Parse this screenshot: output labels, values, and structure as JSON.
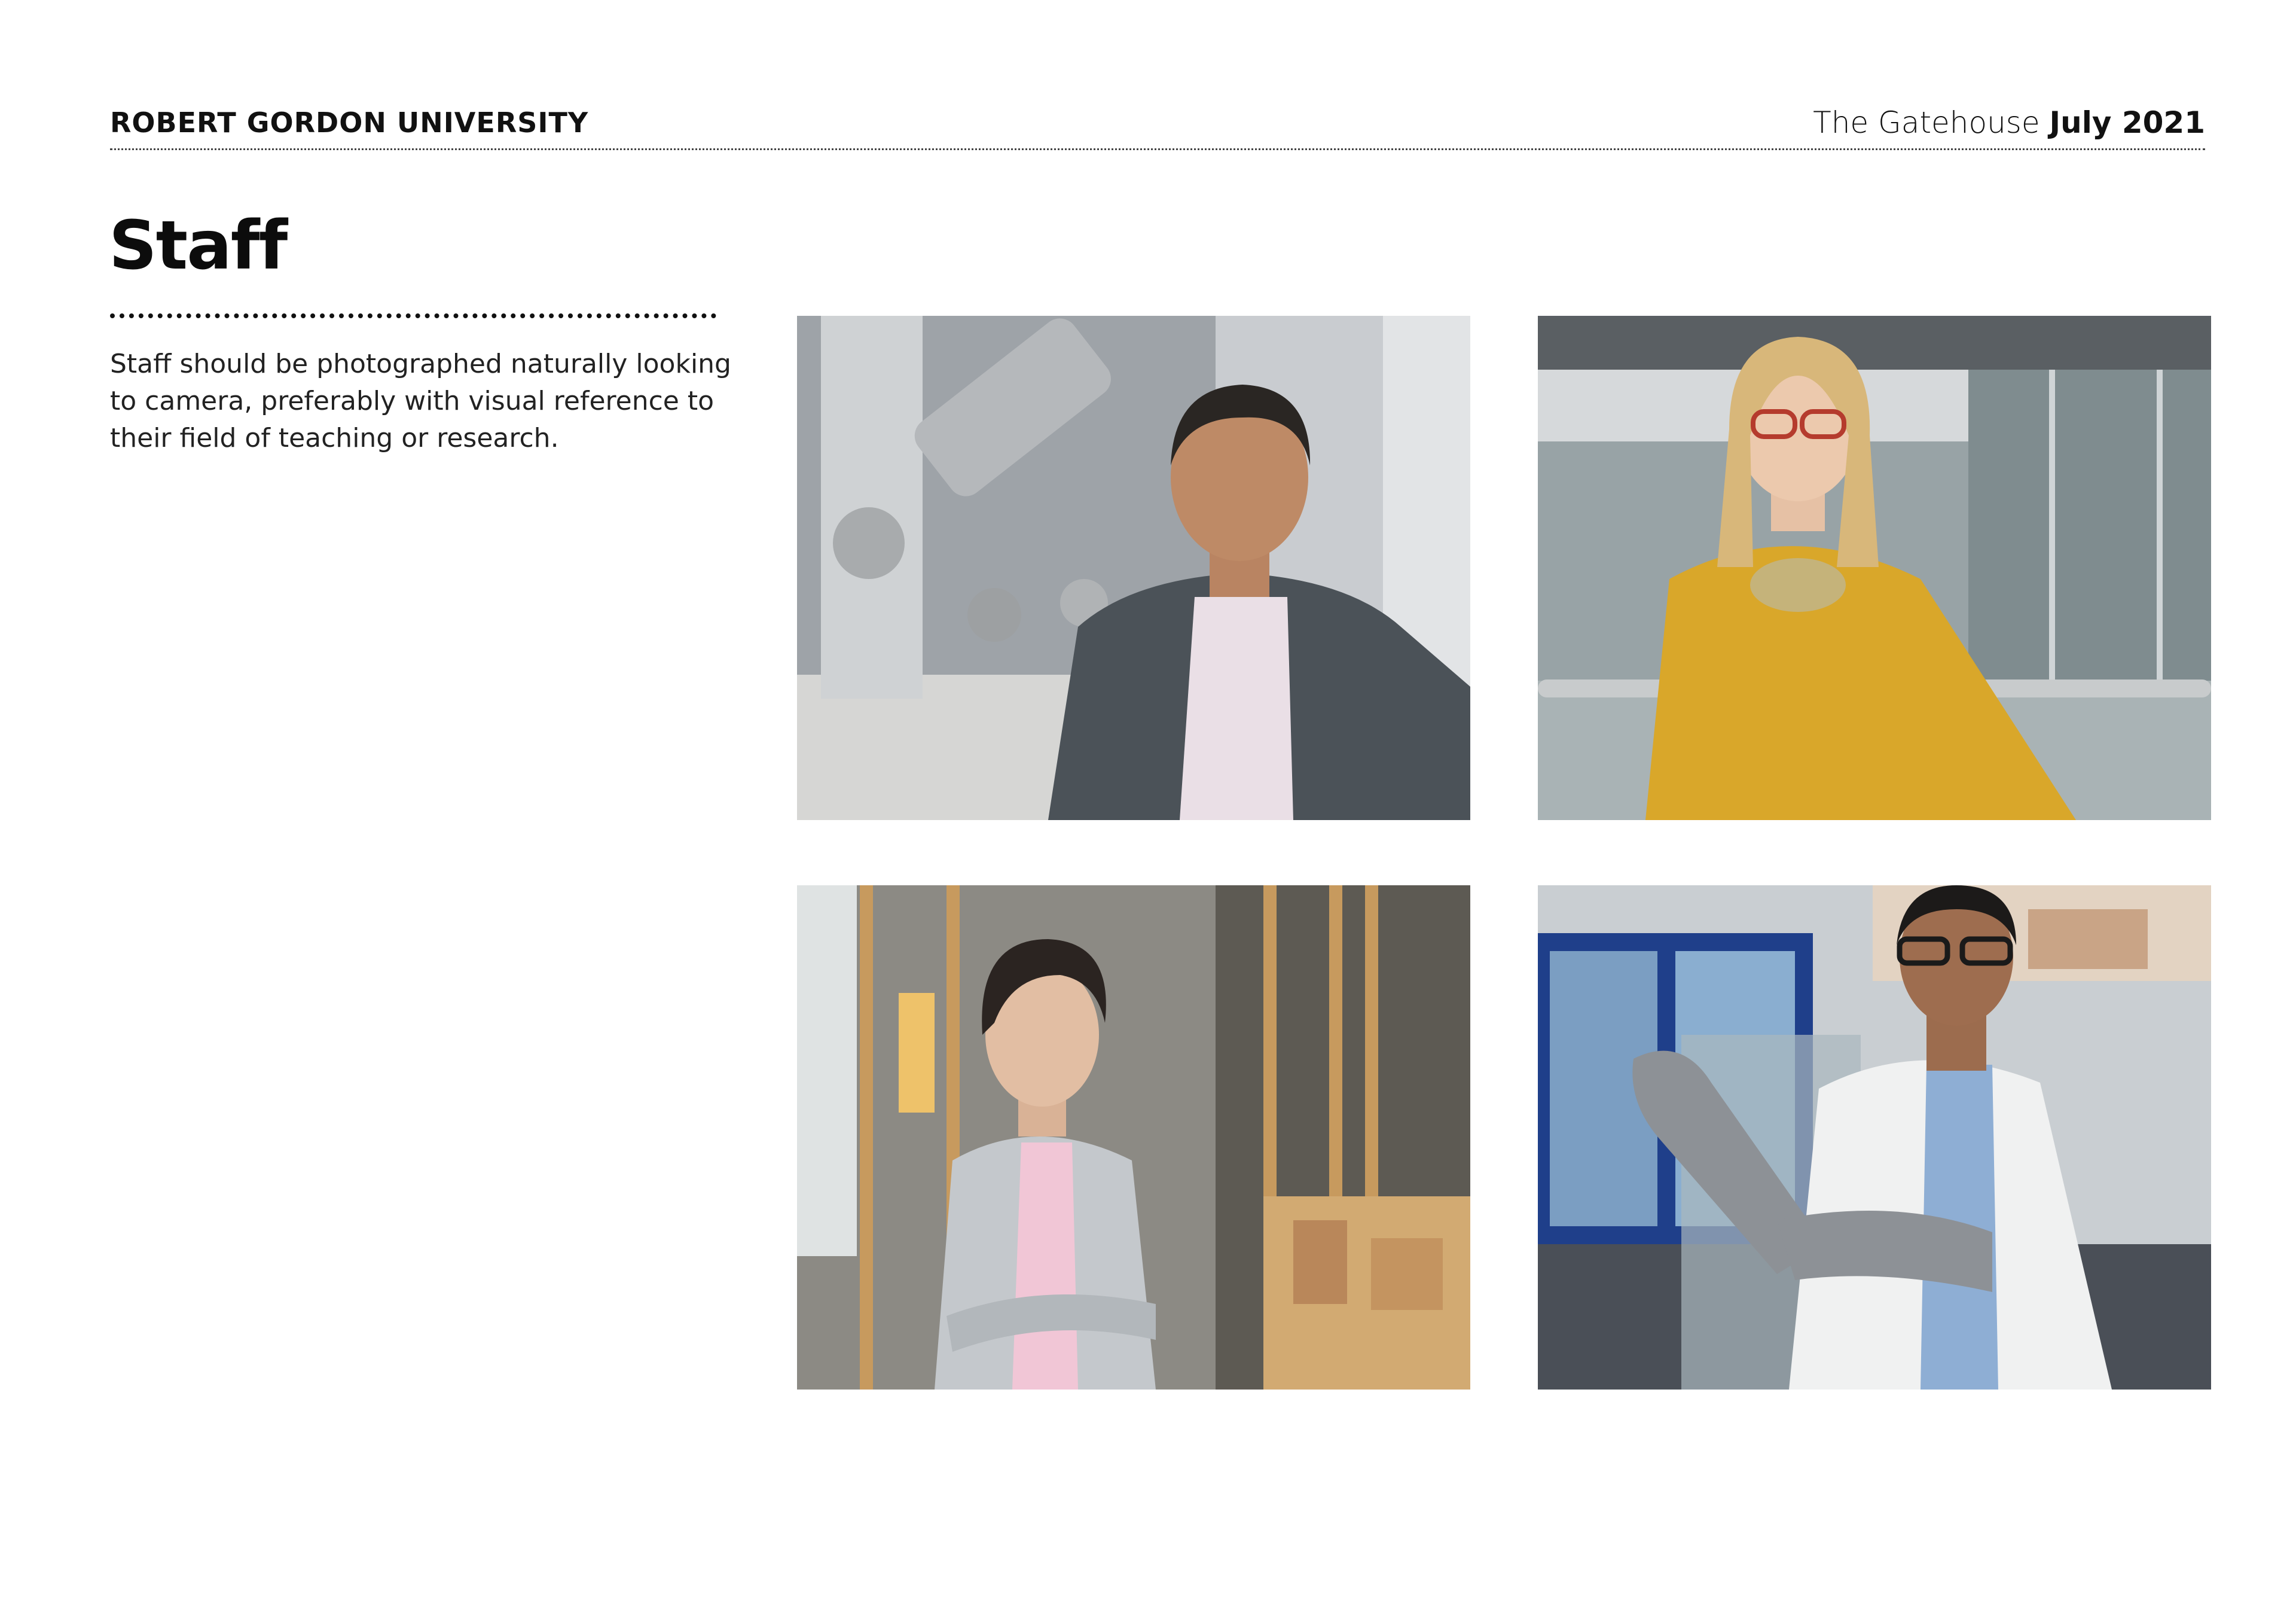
{
  "header": {
    "organization": "ROBERT GORDON UNIVERSITY",
    "publication_name": "The Gatehouse",
    "publication_date": "July 2021"
  },
  "section": {
    "title": "Staff",
    "description": "Staff should be photographed naturally looking to camera, preferably with visual reference to their field of teaching or research."
  },
  "photos": [
    {
      "subject": "staff-portrait-lab-equipment"
    },
    {
      "subject": "staff-portrait-yellow-sweater"
    },
    {
      "subject": "staff-portrait-architecture-models"
    },
    {
      "subject": "staff-portrait-lab-coat-gloves"
    }
  ],
  "colors": {
    "text": "#111111",
    "yellow_sweater": "#d9a72a",
    "lab_grey": "#8f959c",
    "wood": "#c79a5e",
    "lab_blue": "#1f3f8a"
  }
}
